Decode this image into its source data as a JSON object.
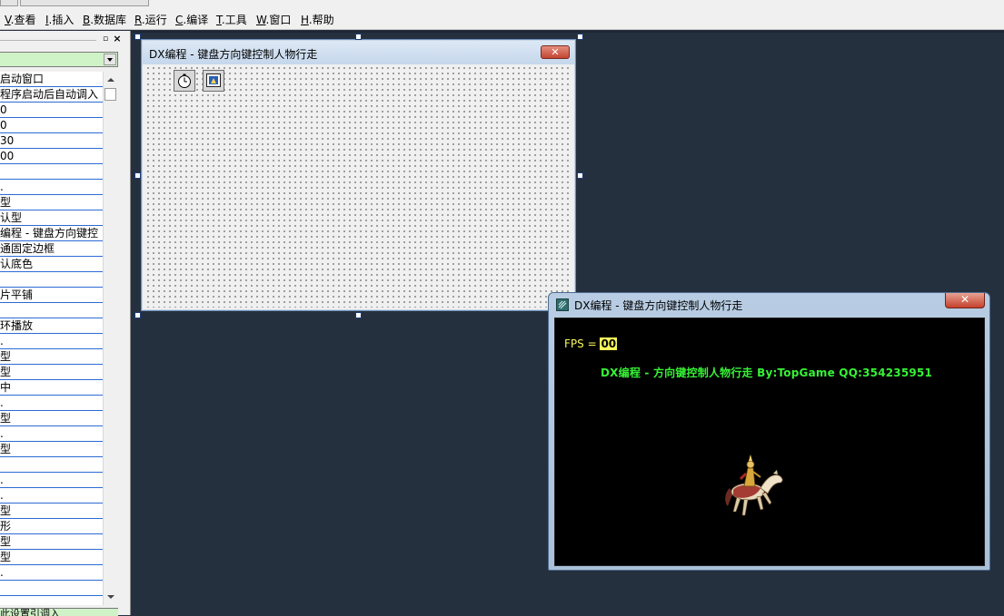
{
  "menubar": {
    "items": [
      {
        "accel": "V",
        "label": ".查看"
      },
      {
        "accel": "I",
        "label": ".插入"
      },
      {
        "accel": "B",
        "label": ".数据库"
      },
      {
        "accel": "R",
        "label": ".运行"
      },
      {
        "accel": "C",
        "label": ".编译"
      },
      {
        "accel": "T",
        "label": ".工具"
      },
      {
        "accel": "W",
        "label": ".窗口"
      },
      {
        "accel": "H",
        "label": ".帮助"
      }
    ]
  },
  "property_panel": {
    "pin_glyph": "▫",
    "close_glyph": "×",
    "rows": [
      "启动窗口",
      "程序启动后自动调入",
      "0",
      "0",
      "30",
      "00",
      "",
      ".",
      "型",
      "认型",
      "编程 - 键盘方向键控",
      "通固定边框",
      "认底色",
      "",
      "片平铺",
      "",
      "环播放",
      ".",
      "型",
      "型",
      "中",
      ".",
      "型",
      ".",
      "型",
      "",
      ".",
      ".",
      "型",
      "形",
      "型",
      "型",
      ".",
      ""
    ],
    "bottom_text": "此设置引调入"
  },
  "design_form": {
    "title": "DX编程 - 键盘方向键控制人物行走",
    "close_glyph": "✕",
    "components": [
      "timer-component-icon",
      "dx-screen-component-icon"
    ]
  },
  "dx_window": {
    "title": "DX编程 - 键盘方向键控制人物行走",
    "close_glyph": "✕",
    "fps_label": "FPS = ",
    "fps_value": "00",
    "caption": "DX编程 - 方向键控制人物行走  By:TopGame QQ:354235951",
    "colors": {
      "fps": "#f7f75a",
      "caption": "#36f236",
      "canvas": "#000000"
    }
  },
  "colors": {
    "workspace": "#25303f",
    "property_combo": "#cff2c7",
    "grid_line": "#2b6ad3"
  }
}
